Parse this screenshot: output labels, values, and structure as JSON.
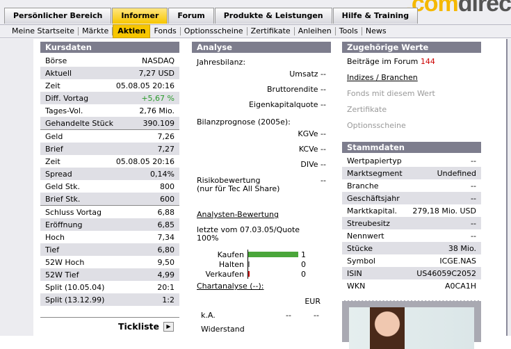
{
  "logo": {
    "text_a": ".com",
    "text_b": "direc"
  },
  "main_tabs": [
    "Persönlicher Bereich",
    "Informer",
    "Forum",
    "Produkte & Leistungen",
    "Hilfe & Training"
  ],
  "sub_tabs": [
    "Meine Startseite",
    "Märkte",
    "Aktien",
    "Fonds",
    "Optionsscheine",
    "Zertifikate",
    "Anleihen",
    "Tools",
    "News"
  ],
  "kursdaten": {
    "title": "Kursdaten",
    "groups": [
      [
        [
          "Börse",
          "NASDAQ"
        ],
        [
          "Aktuell",
          "7,27 USD"
        ],
        [
          "Zeit",
          "05.08.05  20:16"
        ],
        [
          "Diff. Vortag",
          "+5,67 %"
        ],
        [
          "Tages-Vol.",
          "2,76 Mio."
        ],
        [
          "Gehandelte Stück",
          "390.109"
        ]
      ],
      [
        [
          "Geld",
          "7,26"
        ],
        [
          "Brief",
          "7,27"
        ],
        [
          "Zeit",
          "05.08.05  20:16"
        ],
        [
          "Spread",
          "0,14%"
        ],
        [
          "Geld Stk.",
          "800"
        ],
        [
          "Brief Stk.",
          "600"
        ]
      ],
      [
        [
          "Schluss Vortag",
          "6,88"
        ],
        [
          "Eröffnung",
          "6,85"
        ],
        [
          "Hoch",
          "7,34"
        ],
        [
          "Tief",
          "6,80"
        ],
        [
          "52W Hoch",
          "9,50"
        ],
        [
          "52W Tief",
          "4,99"
        ],
        [
          "Split (10.05.04)",
          "20:1"
        ],
        [
          "Split (13.12.99)",
          "1:2"
        ]
      ]
    ],
    "tickliste": "Tickliste"
  },
  "analyse": {
    "title": "Analyse",
    "jahresbilanz": "Jahresbilanz:",
    "jb_rows": [
      [
        "Umsatz",
        "--"
      ],
      [
        "Bruttorendite",
        "--"
      ],
      [
        "Eigenkapitalquote",
        "--"
      ]
    ],
    "prognose": "Bilanzprognose (2005e):",
    "pg_rows": [
      [
        "KGVe",
        "--"
      ],
      [
        "KCVe",
        "--"
      ],
      [
        "DIVe",
        "--"
      ]
    ],
    "risiko_a": "Risikobewertung",
    "risiko_b": "(nur für Tec All Share)",
    "risiko_val": "--",
    "bewertung": "Analysten-Bewertung",
    "letzte_a": "letzte vom 07.03.05/Quote",
    "letzte_b": "100%",
    "ratings": [
      {
        "label": "Kaufen",
        "count": "1",
        "color": "#4aa63a",
        "frac": 1
      },
      {
        "label": "Halten",
        "count": "0",
        "color": "#888888",
        "frac": 0
      },
      {
        "label": "Verkaufen",
        "count": "0",
        "color": "#cc0000",
        "frac": 0
      }
    ],
    "chartanalyse": "Chartanalyse (--):",
    "currency": "EUR",
    "ka": "k.A.",
    "ka_v1": "--",
    "ka_v2": "--",
    "widerstand": "Widerstand"
  },
  "zugehoerig": {
    "title": "Zugehörige Werte",
    "forum": "Beiträge im Forum",
    "forum_count": "144",
    "indizes": "Indizes / Branchen",
    "fonds": "Fonds mit diesem Wert",
    "zert": "Zertifikate",
    "opt": "Optionsscheine"
  },
  "stammdaten": {
    "title": "Stammdaten",
    "rows": [
      [
        "Wertpapiertyp",
        "--"
      ],
      [
        "Marktsegment",
        "Undefined"
      ],
      [
        "Branche",
        "--"
      ],
      [
        "Geschäftsjahr",
        "--"
      ],
      [
        "Marktkapital.",
        "279,18 Mio. USD"
      ],
      [
        "Streubesitz",
        "--"
      ],
      [
        "Nennwert",
        "--"
      ],
      [
        "Stücke",
        "38 Mio."
      ],
      [
        "Symbol",
        "ICGE.NAS"
      ],
      [
        "ISIN",
        "US46059C2052"
      ],
      [
        "WKN",
        "A0CA1H"
      ]
    ]
  }
}
